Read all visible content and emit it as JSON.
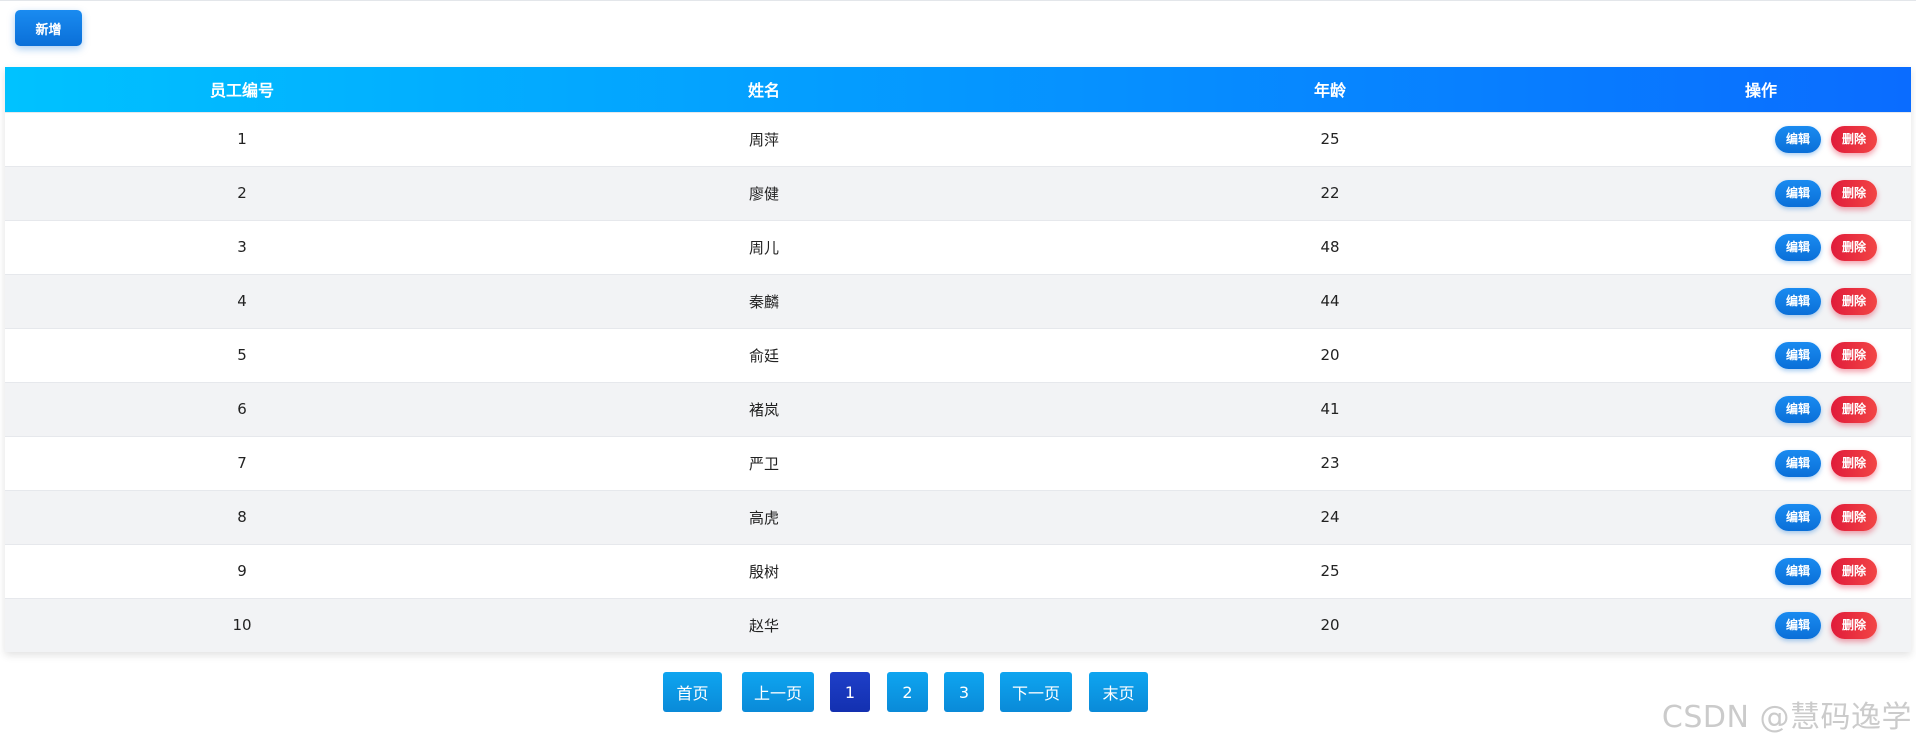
{
  "toolbar": {
    "add_label": "新增"
  },
  "table": {
    "headers": [
      "员工编号",
      "姓名",
      "年龄",
      "操作"
    ],
    "rows": [
      {
        "id": "1",
        "name": "周萍",
        "age": "25"
      },
      {
        "id": "2",
        "name": "廖健",
        "age": "22"
      },
      {
        "id": "3",
        "name": "周儿",
        "age": "48"
      },
      {
        "id": "4",
        "name": "秦麟",
        "age": "44"
      },
      {
        "id": "5",
        "name": "俞廷",
        "age": "20"
      },
      {
        "id": "6",
        "name": "褚岚",
        "age": "41"
      },
      {
        "id": "7",
        "name": "严卫",
        "age": "23"
      },
      {
        "id": "8",
        "name": "高虎",
        "age": "24"
      },
      {
        "id": "9",
        "name": "殷树",
        "age": "25"
      },
      {
        "id": "10",
        "name": "赵华",
        "age": "20"
      }
    ],
    "edit_label": "编辑",
    "delete_label": "删除"
  },
  "pagination": {
    "first": "首页",
    "prev": "上一页",
    "pages": [
      "1",
      "2",
      "3"
    ],
    "current": "1",
    "next": "下一页",
    "last": "末页"
  },
  "watermark": "CSDN @慧码逸学",
  "colors": {
    "header_gradient_start": "#00c2ff",
    "header_gradient_end": "#0a6cff",
    "edit_button": "#0a7fe4",
    "delete_button": "#e8263f",
    "active_page": "#1a35bc"
  }
}
